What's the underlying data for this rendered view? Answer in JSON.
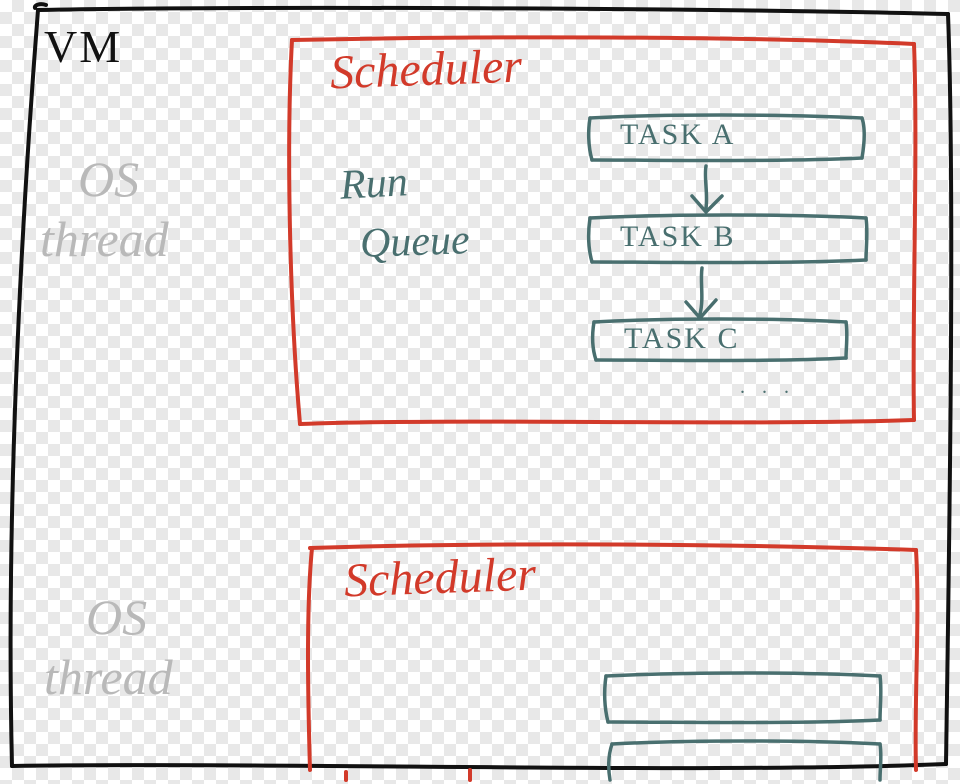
{
  "colors": {
    "vm_outline": "#111111",
    "scheduler_box": "#d23a2a",
    "os_thread_text": "#b9b9b9",
    "content_text": "#496f6f"
  },
  "vm": {
    "label": "VM"
  },
  "threads": [
    {
      "label_lines": [
        "OS",
        "thread"
      ],
      "scheduler": {
        "title": "Scheduler",
        "run_queue_label_lines": [
          "Run",
          "Queue"
        ],
        "tasks": [
          "TASK A",
          "TASK B",
          "TASK C"
        ],
        "ellipsis": ". . ."
      }
    },
    {
      "label_lines": [
        "OS",
        "thread"
      ],
      "scheduler": {
        "title": "Scheduler",
        "tasks_shown_empty": true
      }
    }
  ]
}
